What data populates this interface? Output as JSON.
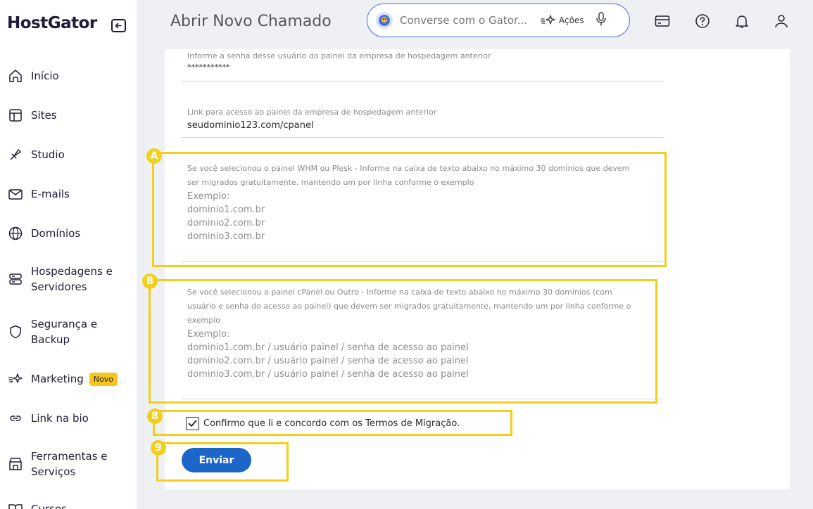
{
  "brand": {
    "logo_text": "HostGator"
  },
  "sidebar": {
    "items": [
      {
        "label": "Início",
        "icon": "home-icon"
      },
      {
        "label": "Sites",
        "icon": "layout-icon"
      },
      {
        "label": "Studio",
        "icon": "brush-icon"
      },
      {
        "label": "E-mails",
        "icon": "mail-icon"
      },
      {
        "label": "Domínios",
        "icon": "globe-icon"
      },
      {
        "label": "Hospedagens e Servidores",
        "icon": "server-icon"
      },
      {
        "label": "Segurança e Backup",
        "icon": "shield-icon"
      },
      {
        "label": "Marketing",
        "icon": "sparkle-icon",
        "badge": "Novo"
      },
      {
        "label": "Link na bio",
        "icon": "link-icon"
      },
      {
        "label": "Ferramentas e Serviços",
        "icon": "store-icon"
      },
      {
        "label": "Cursos",
        "icon": "book-icon"
      }
    ]
  },
  "header": {
    "title": "Abrir Novo Chamado",
    "search_placeholder": "Converse com o Gator...",
    "actions_label": "Ações"
  },
  "form": {
    "password_field": {
      "label": "Informe a senha desse usuário do painel da empresa de hospedagem anterior",
      "value": "***********"
    },
    "link_field": {
      "label": "Link para acesso ao painel da empresa de hospedagem anterior",
      "value": "seudominio123.com/cpanel"
    },
    "whm_field": {
      "label_line1": "Se você selecionou o painel WHM ou Plesk - Informe na caixa de texto abaixo no máximo 30 domínios que devem",
      "label_line2": "ser migrados gratuitamente, mantendo um por linha conforme o exemplo",
      "example": [
        "Exemplo:",
        "dominio1.com.br",
        "dominio2.com.br",
        "dominio3.com.br"
      ]
    },
    "cpanel_field": {
      "label_line1": "Se você selecionou o painel cPanel ou Outro - Informe na caixa de texto abaixo no máximo 30 domínios (com",
      "label_line2": "usuário e senha do acesso ao painel) que devem ser migrados gratuitamente, mantendo um por linha conforme o",
      "label_line3": "exemplo",
      "example": [
        "Exemplo:",
        "dominio1.com.br / usuário painel / senha de acesso ao painel",
        "dominio2.com.br  / usuário painel / senha de acesso ao painel",
        "dominio3.com.br  / usuário painel / senha de acesso ao painel"
      ]
    },
    "terms_checkbox": {
      "label": "Confirmo que li e concordo com os Termos de Migração.",
      "checked": true
    },
    "submit_label": "Enviar"
  },
  "annotations": {
    "marker_a": "A",
    "marker_b": "B",
    "marker_8": "8",
    "marker_9": "9",
    "highlight_color": "#f1cf1d"
  },
  "colors": {
    "accent": "#1c65c9",
    "search_border": "#4d6fd9",
    "badge": "#f5c518"
  }
}
